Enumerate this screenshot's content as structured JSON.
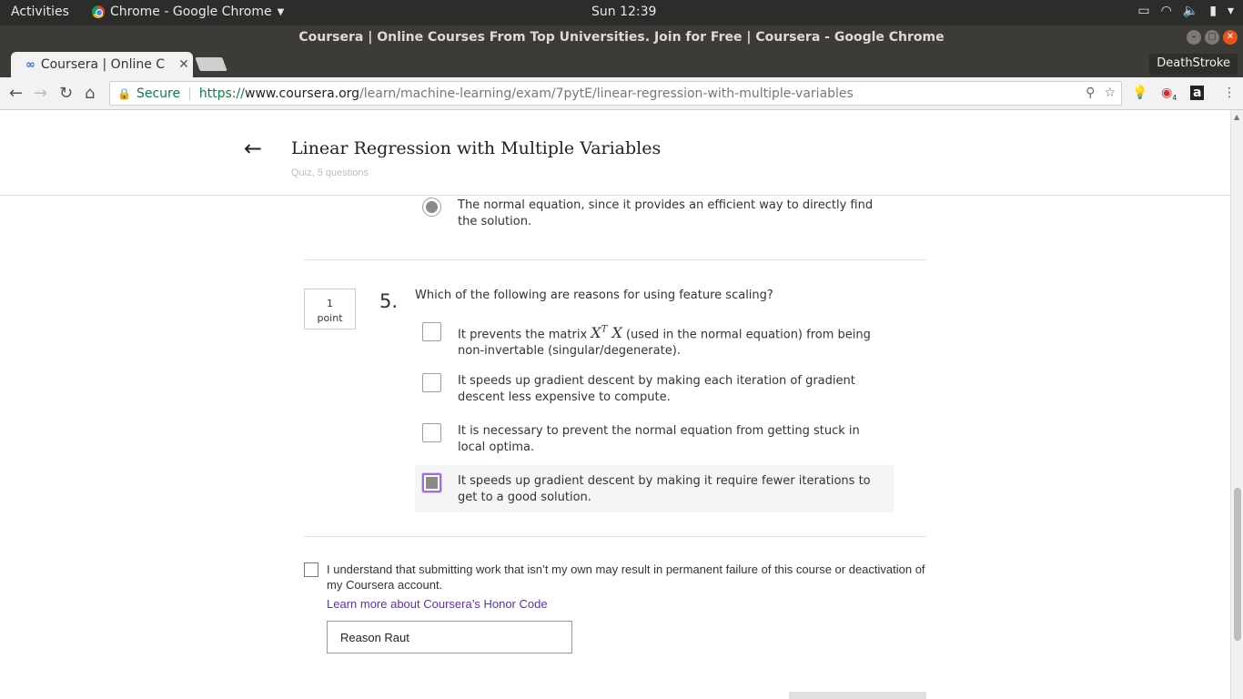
{
  "system_bar": {
    "activities": "Activities",
    "app_name": "Chrome - Google Chrome",
    "clock": "Sun 12:39"
  },
  "window": {
    "title": "Coursera | Online Courses From Top Universities. Join for Free | Coursera - Google Chrome"
  },
  "tabs": [
    {
      "label": "Coursera | Online C"
    }
  ],
  "profile": {
    "name": "DeathStroke"
  },
  "address_bar": {
    "secure_label": "Secure",
    "scheme": "https://",
    "domain": "www.coursera.org",
    "path": "/learn/machine-learning/exam/7pytE/linear-regression-with-multiple-variables"
  },
  "extensions": {
    "badge_count": "4"
  },
  "quiz": {
    "title": "Linear Regression with Multiple Variables",
    "subtitle": "Quiz, 5 questions"
  },
  "previous_question": {
    "selected_option": "The normal equation, since it provides an efficient way to directly find the solution."
  },
  "question5": {
    "points_value": "1",
    "points_label": "point",
    "number": "5.",
    "text": "Which of the following are reasons for using feature scaling?",
    "options": [
      {
        "before": "It prevents the matrix ",
        "math_base": "X",
        "math_sup": "T",
        "math_after": "X",
        "after": " (used in the normal equation) from being non-invertable (singular/degenerate).",
        "checked": false
      },
      {
        "label": "It speeds up gradient descent by making each iteration of gradient descent less expensive to compute.",
        "checked": false
      },
      {
        "label": "It is necessary to prevent the normal equation from getting stuck in local optima.",
        "checked": false
      },
      {
        "label": "It speeds up gradient descent by making it require fewer iterations to get to a good solution.",
        "checked": true
      }
    ]
  },
  "honor_code": {
    "statement": "I understand that submitting work that isn’t my own may result in permanent failure of this course or deactivation of my Coursera account.",
    "link_text": "Learn more about Coursera’s Honor Code",
    "name_value": "Reason Raut"
  },
  "colors": {
    "accent_purple": "#a16ae8",
    "link_purple": "#5c2fc2",
    "secure_green": "#0b8043"
  }
}
